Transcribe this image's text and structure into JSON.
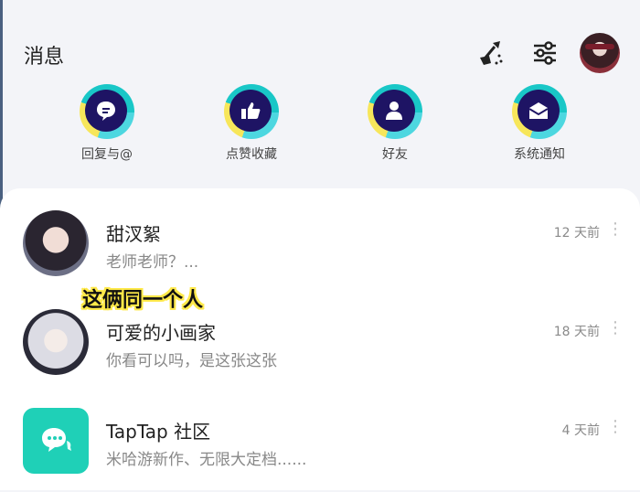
{
  "header": {
    "title": "消息"
  },
  "categories": [
    {
      "label": "回复与@",
      "icon": "chat-bubble-icon"
    },
    {
      "label": "点赞收藏",
      "icon": "thumbs-up-icon"
    },
    {
      "label": "好友",
      "icon": "person-icon"
    },
    {
      "label": "系统通知",
      "icon": "envelope-icon"
    }
  ],
  "messages": [
    {
      "name": "甜汊絮",
      "preview": "老师老师？...",
      "time": "12 天前"
    },
    {
      "name": "可爱的小画家",
      "preview": "你看可以吗，是这张这张",
      "time": "18 天前"
    },
    {
      "name": "TapTap 社区",
      "preview": "米哈游新作、无限大定档......",
      "time": "4 天前"
    }
  ],
  "overlay_caption": "这俩同一个人",
  "colors": {
    "icon_core": "#1e1464",
    "ring_cyan": "#19c7c7",
    "ring_yellow": "#f7e65a",
    "taptap_green": "#1fd0b7",
    "caption_outline": "#ffe949"
  }
}
